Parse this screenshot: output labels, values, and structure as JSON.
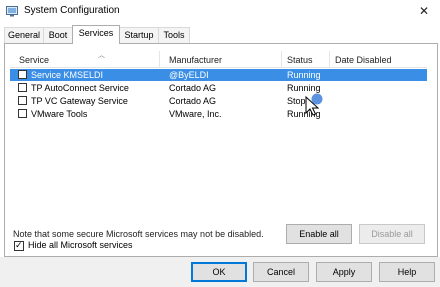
{
  "window": {
    "title": "System Configuration",
    "close_glyph": "✕"
  },
  "tabs": [
    {
      "label": "General"
    },
    {
      "label": "Boot"
    },
    {
      "label": "Services",
      "active": true
    },
    {
      "label": "Startup"
    },
    {
      "label": "Tools"
    }
  ],
  "table": {
    "columns": [
      "Service",
      "Manufacturer",
      "Status",
      "Date Disabled"
    ],
    "rows": [
      {
        "service": "Service KMSELDI",
        "manufacturer": "@ByELDI",
        "status": "Running",
        "date_disabled": "",
        "checked": false,
        "selected": true
      },
      {
        "service": "TP AutoConnect Service",
        "manufacturer": "Cortado AG",
        "status": "Running",
        "date_disabled": "",
        "checked": false
      },
      {
        "service": "TP VC Gateway Service",
        "manufacturer": "Cortado AG",
        "status": "Stop",
        "date_disabled": "",
        "checked": false
      },
      {
        "service": "VMware Tools",
        "manufacturer": "VMware, Inc.",
        "status": "Running",
        "date_disabled": "",
        "checked": false
      }
    ]
  },
  "note": "Note that some secure Microsoft services may not be disabled.",
  "buttons": {
    "enable_all": "Enable all",
    "disable_all": "Disable all"
  },
  "hide_microsoft": {
    "label": "Hide all Microsoft services",
    "checked": true,
    "check_glyph": "✓"
  },
  "footer": {
    "ok": "OK",
    "cancel": "Cancel",
    "apply": "Apply",
    "help": "Help"
  },
  "colors": {
    "selection": "#3a8ee6",
    "accent": "#0078d7"
  }
}
